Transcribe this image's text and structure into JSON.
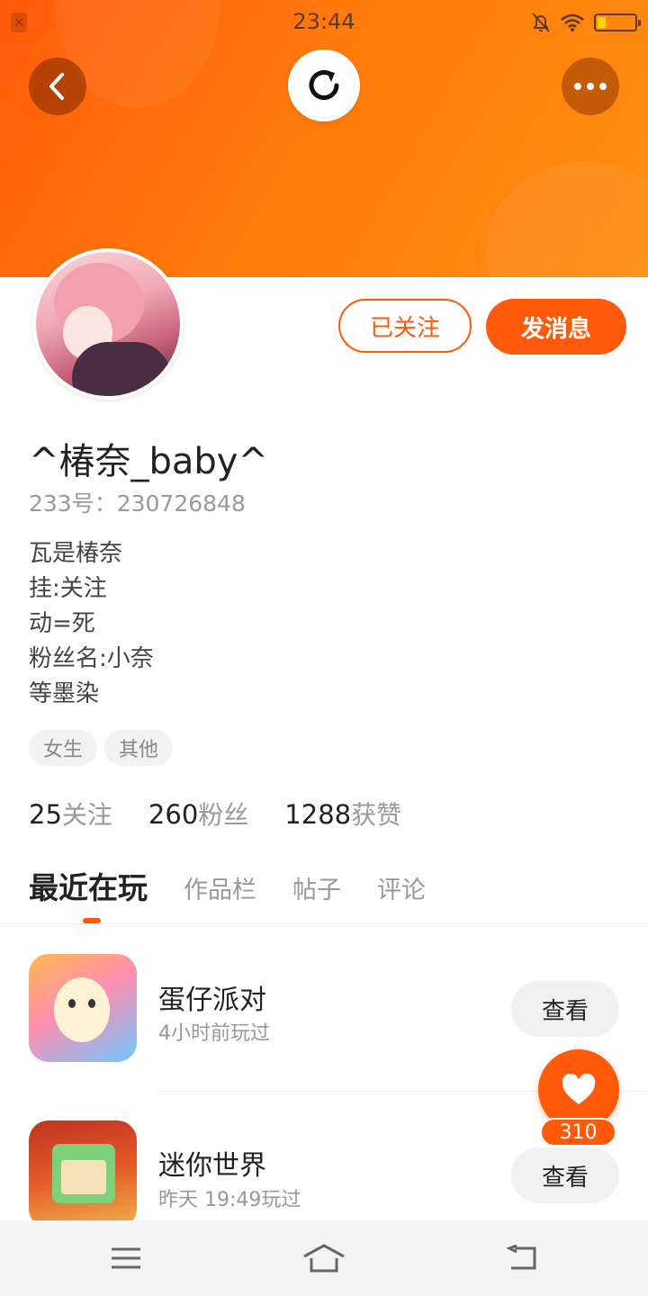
{
  "status_bar": {
    "time": "23:44",
    "left_icon": "close-badge-icon",
    "icons": [
      "mute-bell-icon",
      "wifi-icon",
      "battery-icon"
    ],
    "battery_level": 0.2
  },
  "header": {
    "back_icon": "back-arrow-icon",
    "refresh_icon": "refresh-icon",
    "more_icon": "more-dots-icon"
  },
  "profile": {
    "username": "^椿奈_baby^",
    "uid": "233号：230726848",
    "bio": [
      "瓦是椿奈",
      "挂:关注",
      "动=死",
      "粉丝名:小奈",
      "等墨染"
    ],
    "tags": [
      "女生",
      "其他"
    ],
    "followed_label": "已关注",
    "message_label": "发消息"
  },
  "stats": [
    {
      "num": "25",
      "label": "关注"
    },
    {
      "num": "260",
      "label": "粉丝"
    },
    {
      "num": "1288",
      "label": "获赞"
    }
  ],
  "tabs": [
    "最近在玩",
    "作品栏",
    "帖子",
    "评论"
  ],
  "games": [
    {
      "name": "蛋仔派对",
      "time": "4小时前玩过",
      "button": "查看"
    },
    {
      "name": "迷你世界",
      "time": "昨天 19:49玩过",
      "button": "查看"
    }
  ],
  "like": {
    "count": "310"
  },
  "colors": {
    "accent": "#ff5a0a",
    "header_gradient": [
      "#ff5a0a",
      "#ff8f12"
    ]
  },
  "nav": {
    "icons": [
      "menu-icon",
      "home-icon",
      "back-icon"
    ]
  }
}
